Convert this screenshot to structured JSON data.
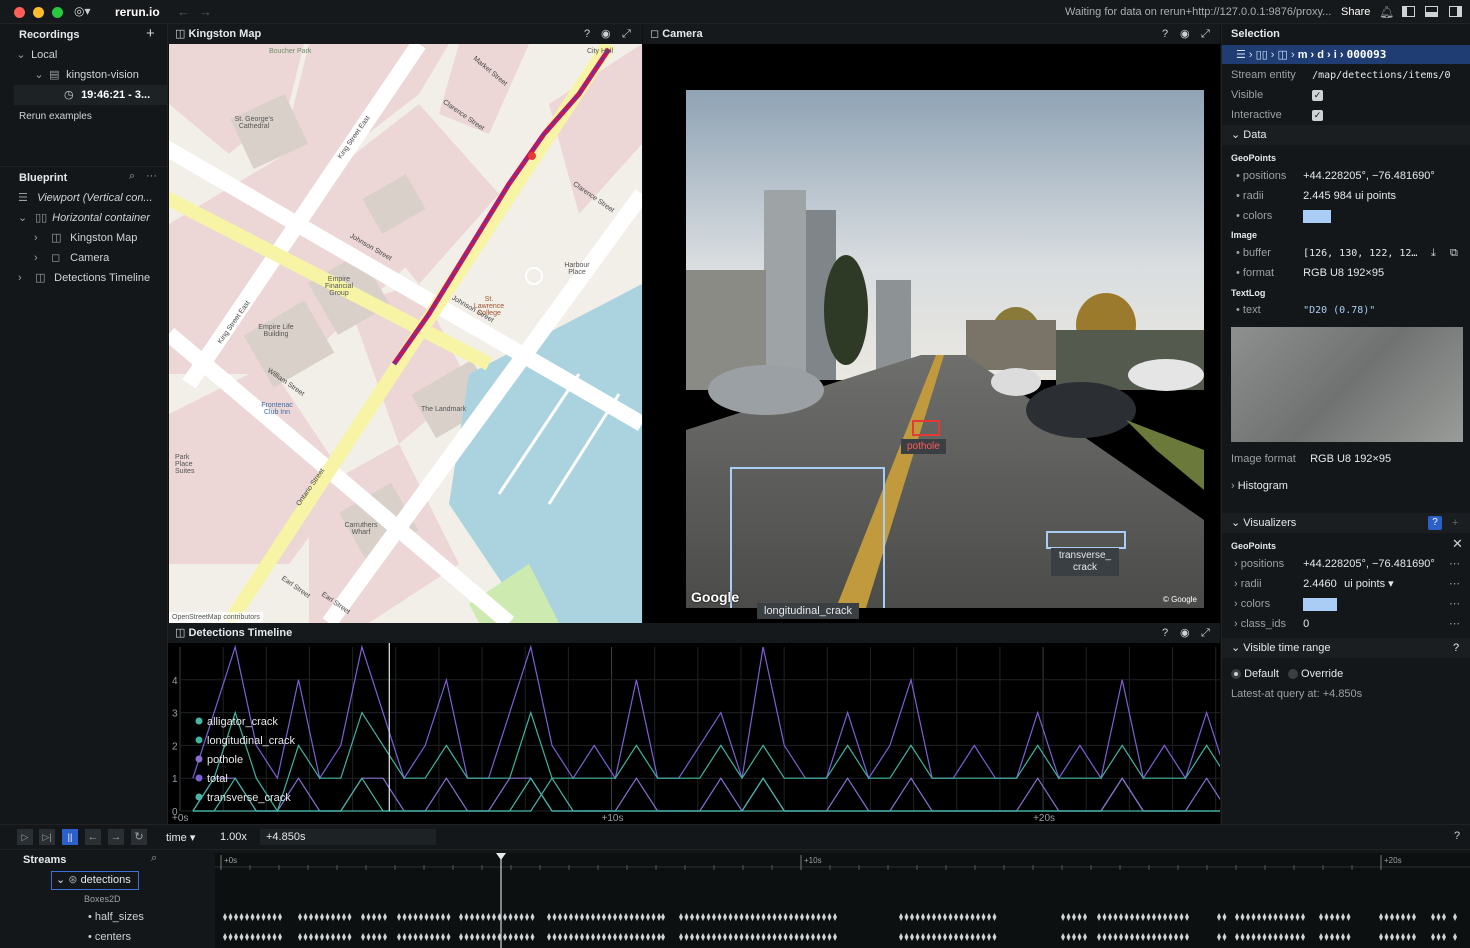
{
  "titlebar": {
    "app_name": "rerun.io",
    "status": "Waiting for data on rerun+http://127.0.0.1:9876/proxy...",
    "share": "Share"
  },
  "recordings": {
    "title": "Recordings",
    "local": "Local",
    "app": "kingston-vision",
    "recording": "19:46:21 - 3...",
    "examples": "Rerun examples"
  },
  "blueprint": {
    "title": "Blueprint",
    "items": [
      {
        "label": "Viewport (Vertical con..."
      },
      {
        "label": "Horizontal container"
      },
      {
        "label": "Kingston Map"
      },
      {
        "label": "Camera"
      },
      {
        "label": "Detections Timeline"
      }
    ]
  },
  "map": {
    "title": "Kingston Map",
    "attribution": "OpenStreetMap contributors",
    "labels": {
      "boucher": "Boucher Park",
      "cathedral": "St. George's Cathedral",
      "market": "Market Street",
      "clarence1": "Clarence Street",
      "clarence2": "Clarence Street",
      "kingEast1": "King Street East",
      "kingEast2": "King Street East",
      "johnson1": "Johnson Street",
      "johnson2": "Johnson Street",
      "ontario1": "Ontario Street",
      "ontario2": "Ontario Street",
      "william": "William Street",
      "earl1": "Earl Street",
      "earl2": "Earl Street",
      "empireFin": "Empire Financial Group",
      "empireLife": "Empire Life Building",
      "landmark": "The Landmark",
      "carruthers": "Carruthers Wharf",
      "harbourPlace": "Harbour Place",
      "parkPlace": "Park Place Suites",
      "frontenac": "Frontenac Club Inn",
      "cityHall": "City Hall",
      "stLawrence": "St. Lawrence College"
    }
  },
  "camera": {
    "title": "Camera",
    "google1": "Google",
    "google2": "© Google",
    "boxes": [
      {
        "label": "pothole"
      },
      {
        "label": "transverse_ crack"
      },
      {
        "label": "longitudinal_crack"
      }
    ]
  },
  "selection": {
    "title": "Selection",
    "path_tail": "000093",
    "stream_entity_label": "Stream entity",
    "stream_entity": "/map/detections/items/0",
    "visible": "Visible",
    "interactive": "Interactive",
    "data_title": "Data",
    "geopoints": "GeoPoints",
    "positions_k": "positions",
    "positions_v": "+44.228205°, −76.481690°",
    "radii_k": "radii",
    "radii_v": "2.445 984 ui points",
    "colors_k": "colors",
    "image": "Image",
    "buffer_k": "buffer",
    "buffer_v": "[126, 130, 122, 12…",
    "format_k": "format",
    "format_v": "RGB U8 192×95",
    "textlog": "TextLog",
    "text_k": "text",
    "text_v": "\"D20 (0.78)\"",
    "image_format_k": "Image format",
    "image_format_v": "RGB U8 192×95",
    "histogram": "Histogram",
    "visualizers": "Visualizers",
    "viz_geopoints": "GeoPoints",
    "viz_positions_v": "+44.228205°, −76.481690°",
    "viz_radii_v": "2.4460",
    "viz_radii_unit": "ui points",
    "viz_class_ids_k": "class_ids",
    "viz_class_ids_v": "0",
    "visible_time_range": "Visible time range",
    "default": "Default",
    "override": "Override",
    "latest_at": "Latest-at query at: +4.850s",
    "color_swatch": "#a9cdf5"
  },
  "timeline_panel": {
    "title": "Detections Timeline"
  },
  "chart_data": {
    "type": "line",
    "xlabel": "",
    "ylabel": "",
    "x_ticks": [
      "+0s",
      "+10s",
      "+20s"
    ],
    "y_ticks": [
      "0",
      "1",
      "2",
      "3",
      "4"
    ],
    "ylim": [
      0,
      5
    ],
    "xlim": [
      0,
      24.1
    ],
    "cursor": 4.85,
    "series": [
      {
        "name": "transverse_crack",
        "color": "#4fb3a9",
        "values": [
          0,
          0,
          0,
          0,
          0,
          0,
          0,
          0,
          0,
          0,
          0,
          0,
          0,
          0,
          0,
          0,
          0,
          1,
          0,
          0,
          0,
          0,
          0,
          0,
          0,
          0,
          0,
          0,
          0,
          0,
          0,
          0,
          0,
          0,
          0,
          0,
          0,
          0,
          0,
          0,
          0,
          0,
          0,
          0,
          1,
          0,
          0,
          0,
          0,
          0
        ]
      },
      {
        "name": "total",
        "color": "#7d5fd6",
        "values": [
          1,
          3,
          5,
          2,
          1,
          4,
          1,
          2,
          5,
          3,
          1,
          2,
          4,
          1,
          1,
          3,
          5,
          2,
          1,
          2,
          1,
          4,
          1,
          1,
          2,
          3,
          1,
          5,
          2,
          1,
          1,
          3,
          1,
          2,
          4,
          1,
          1,
          2,
          1,
          1,
          3,
          1,
          2,
          1,
          4,
          1,
          2,
          1,
          3,
          1
        ]
      },
      {
        "name": "pothole",
        "color": "#8a6fd0",
        "values": [
          0,
          1,
          1,
          0,
          0,
          1,
          0,
          0,
          1,
          1,
          0,
          0,
          1,
          0,
          0,
          1,
          1,
          0,
          0,
          0,
          0,
          1,
          0,
          0,
          0,
          1,
          0,
          1,
          0,
          0,
          0,
          1,
          0,
          0,
          1,
          0,
          0,
          0,
          0,
          0,
          1,
          0,
          0,
          0,
          1,
          0,
          0,
          0,
          1,
          0
        ]
      },
      {
        "name": "longitudinal_crack",
        "color": "#3fb59f",
        "values": [
          0,
          1,
          3,
          1,
          0,
          2,
          1,
          1,
          3,
          2,
          1,
          1,
          2,
          1,
          1,
          1,
          3,
          1,
          1,
          1,
          1,
          2,
          1,
          1,
          1,
          2,
          1,
          2,
          1,
          1,
          1,
          2,
          1,
          1,
          2,
          1,
          1,
          1,
          1,
          1,
          2,
          1,
          1,
          1,
          2,
          1,
          1,
          1,
          2,
          1
        ]
      },
      {
        "name": "alligator_crack",
        "color": "#45b8a4",
        "values": [
          0,
          0,
          1,
          0,
          0,
          0,
          0,
          0,
          1,
          0,
          0,
          0,
          0,
          0,
          0,
          0,
          1,
          0,
          0,
          0,
          0,
          0,
          0,
          0,
          0,
          0,
          0,
          1,
          0,
          0,
          0,
          0,
          0,
          0,
          0,
          0,
          0,
          0,
          0,
          0,
          0,
          0,
          0,
          0,
          0,
          0,
          0,
          0,
          0,
          0
        ]
      }
    ]
  },
  "time_controls": {
    "timeline": "time",
    "speed": "1.00x",
    "current": "+4.850s"
  },
  "streams": {
    "title": "Streams",
    "entity": "detections",
    "archetype": "Boxes2D",
    "comp1": "half_sizes",
    "comp2": "centers",
    "ticks": [
      "+0s",
      "+10s",
      "+20s"
    ]
  }
}
